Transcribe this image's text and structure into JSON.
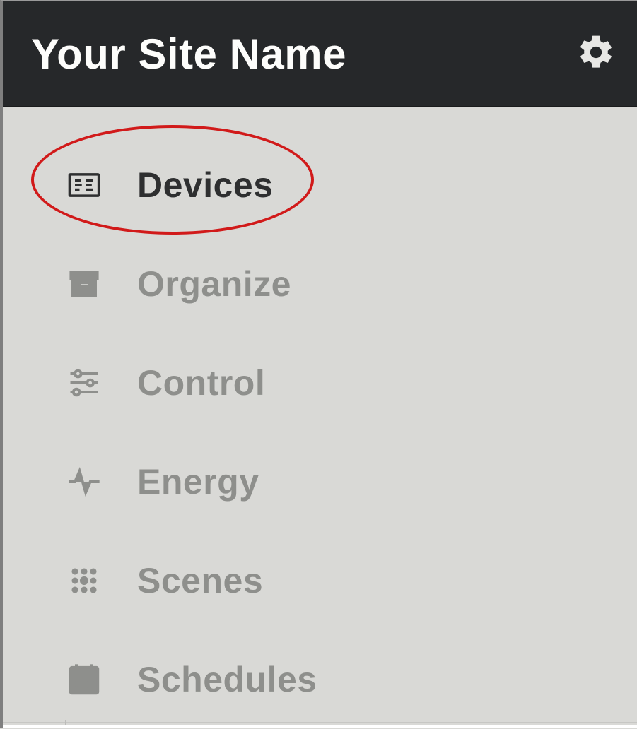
{
  "header": {
    "title": "Your Site Name",
    "settings_icon": "gear-icon"
  },
  "sidebar": {
    "active_index": 0,
    "items": [
      {
        "label": "Devices",
        "icon": "devices-icon"
      },
      {
        "label": "Organize",
        "icon": "archive-icon"
      },
      {
        "label": "Control",
        "icon": "sliders-icon"
      },
      {
        "label": "Energy",
        "icon": "pulse-icon"
      },
      {
        "label": "Scenes",
        "icon": "scenes-icon"
      },
      {
        "label": "Schedules",
        "icon": "calendar-icon"
      }
    ]
  },
  "annotations": {
    "circled_item_index": 0,
    "circle_color": "#d11a1a"
  },
  "colors": {
    "header_bg": "#26282a",
    "page_bg": "#d9d9d6",
    "active_text": "#2e2f30",
    "inactive_text": "#8e8f8c"
  }
}
